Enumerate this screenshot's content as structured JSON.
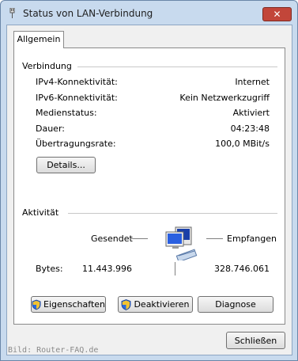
{
  "window": {
    "title": "Status von LAN-Verbindung",
    "close_label": "✕"
  },
  "tabs": [
    {
      "label": "Allgemein",
      "selected": true
    }
  ],
  "connection": {
    "group_label": "Verbindung",
    "rows": [
      {
        "label": "IPv4-Konnektivität:",
        "value": "Internet"
      },
      {
        "label": "IPv6-Konnektivität:",
        "value": "Kein Netzwerkzugriff"
      },
      {
        "label": "Medienstatus:",
        "value": "Aktiviert"
      },
      {
        "label": "Dauer:",
        "value": "04:23:48"
      },
      {
        "label": "Übertragungsrate:",
        "value": "100,0 MBit/s"
      }
    ],
    "details_button": "Details..."
  },
  "activity": {
    "group_label": "Aktivität",
    "sent_label": "Gesendet",
    "received_label": "Empfangen",
    "bytes_label": "Bytes:",
    "bytes_sent": "11.443.996",
    "bytes_received": "328.746.061"
  },
  "actions": {
    "properties": "Eigenschaften",
    "deactivate": "Deaktivieren",
    "diagnose": "Diagnose"
  },
  "footer": {
    "close": "Schließen",
    "watermark": "Bild: Router-FAQ.de"
  },
  "colors": {
    "titlebar_bg": "#c8daee",
    "close_red": "#c2463a",
    "window_bg": "#f0f0f0",
    "panel_bg": "#ffffff",
    "monitor_blue": "#1a3fa8"
  },
  "icons": {
    "title": "network-plug-icon",
    "activity": "network-computers-icon",
    "shield": "uac-shield-icon"
  }
}
